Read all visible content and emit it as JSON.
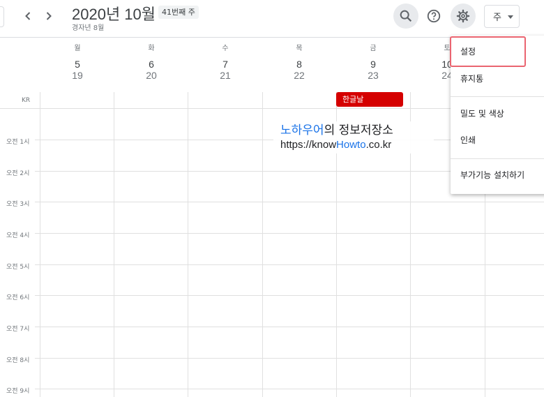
{
  "header": {
    "title": "2020년 10월",
    "week_badge": "41번째 주",
    "subtitle": "경자년 8월",
    "view_label": "주"
  },
  "days": [
    {
      "name": "월",
      "num": "5",
      "lunar": "19"
    },
    {
      "name": "화",
      "num": "6",
      "lunar": "20"
    },
    {
      "name": "수",
      "num": "7",
      "lunar": "21"
    },
    {
      "name": "목",
      "num": "8",
      "lunar": "22"
    },
    {
      "name": "금",
      "num": "9",
      "lunar": "23"
    },
    {
      "name": "토",
      "num": "10",
      "lunar": "24"
    }
  ],
  "allday_label": "KR",
  "time_labels": [
    "오전 1시",
    "오전 2시",
    "오전 3시",
    "오전 4시",
    "오전 5시",
    "오전 6시",
    "오전 7시",
    "오전 8시",
    "오전 9시"
  ],
  "holiday": {
    "label": "한글날"
  },
  "watermark": {
    "line1_blue": "노하우어",
    "line1_rest": "의 정보저장소",
    "line2_pre": "https://know",
    "line2_blue": "Howto",
    "line2_post": ".co.kr"
  },
  "menu": {
    "items": [
      "설정",
      "휴지통",
      "밀도 및 색상",
      "인쇄",
      "부가기능 설치하기"
    ]
  },
  "icons": {
    "prev": "chevron-left-icon",
    "next": "chevron-right-icon",
    "search": "search-icon",
    "help": "help-icon",
    "settings": "gear-icon"
  },
  "colors": {
    "holiday": "#d50000",
    "highlight": "#ea6470",
    "accent_blue": "#1a73e8"
  }
}
